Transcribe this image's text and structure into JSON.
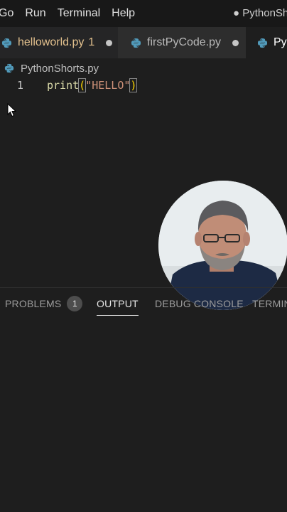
{
  "menubar": {
    "items": [
      "Go",
      "Run",
      "Terminal",
      "Help"
    ],
    "window_title": "● PythonSh"
  },
  "tabs": [
    {
      "label": "helloworld.py",
      "problems": "1",
      "modified": true
    },
    {
      "label": "firstPyCode.py",
      "modified": true
    },
    {
      "label": "Py"
    }
  ],
  "breadcrumb": {
    "file": "PythonShorts.py"
  },
  "editor": {
    "line_number": "1",
    "code": {
      "fn": "print",
      "open": "(",
      "string": "\"HELLO\"",
      "close": ")"
    }
  },
  "panel": {
    "tabs": [
      "PROBLEMS",
      "OUTPUT",
      "DEBUG CONSOLE",
      "TERMIN"
    ],
    "problems_count": "1",
    "active_tab": "OUTPUT"
  },
  "colors": {
    "background": "#1e1e1e",
    "modified_tab_text": "#e2c08d",
    "python_icon": "#519aba",
    "string": "#ce9178",
    "function": "#dcdcaa",
    "bracket": "#ffd700"
  },
  "icons": [
    "python-file-icon",
    "modified-dot-icon",
    "mouse-pointer-icon"
  ]
}
